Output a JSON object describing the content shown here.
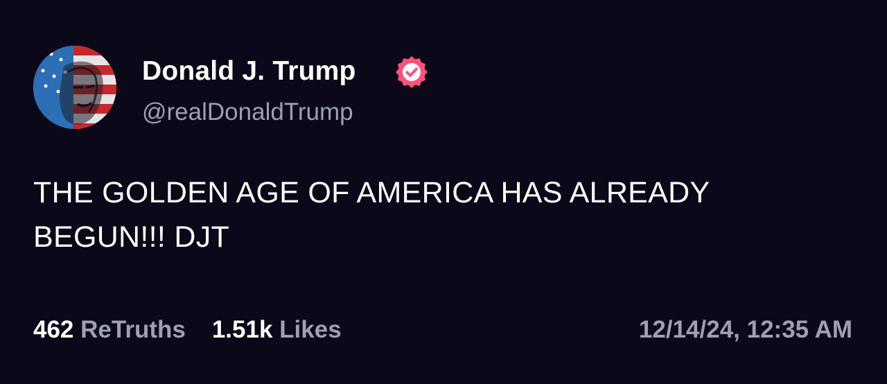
{
  "post": {
    "author": {
      "display_name": "Donald J. Trump",
      "handle": "@realDonaldTrump",
      "verified_icon": "verified-badge-icon",
      "verified_color": "#ff4f7b"
    },
    "content": {
      "line1": "THE GOLDEN AGE OF AMERICA HAS ALREADY",
      "line2": "BEGUN!!! DJT"
    },
    "stats": {
      "retruths_count": "462",
      "retruths_label": "ReTruths",
      "likes_count": "1.51k",
      "likes_label": "Likes"
    },
    "timestamp": "12/14/24, 12:35 AM"
  },
  "colors": {
    "background": "#0a0819",
    "primary_text": "#ffffff",
    "secondary_text": "#9ea0ad",
    "accent": "#ff4f7b"
  }
}
